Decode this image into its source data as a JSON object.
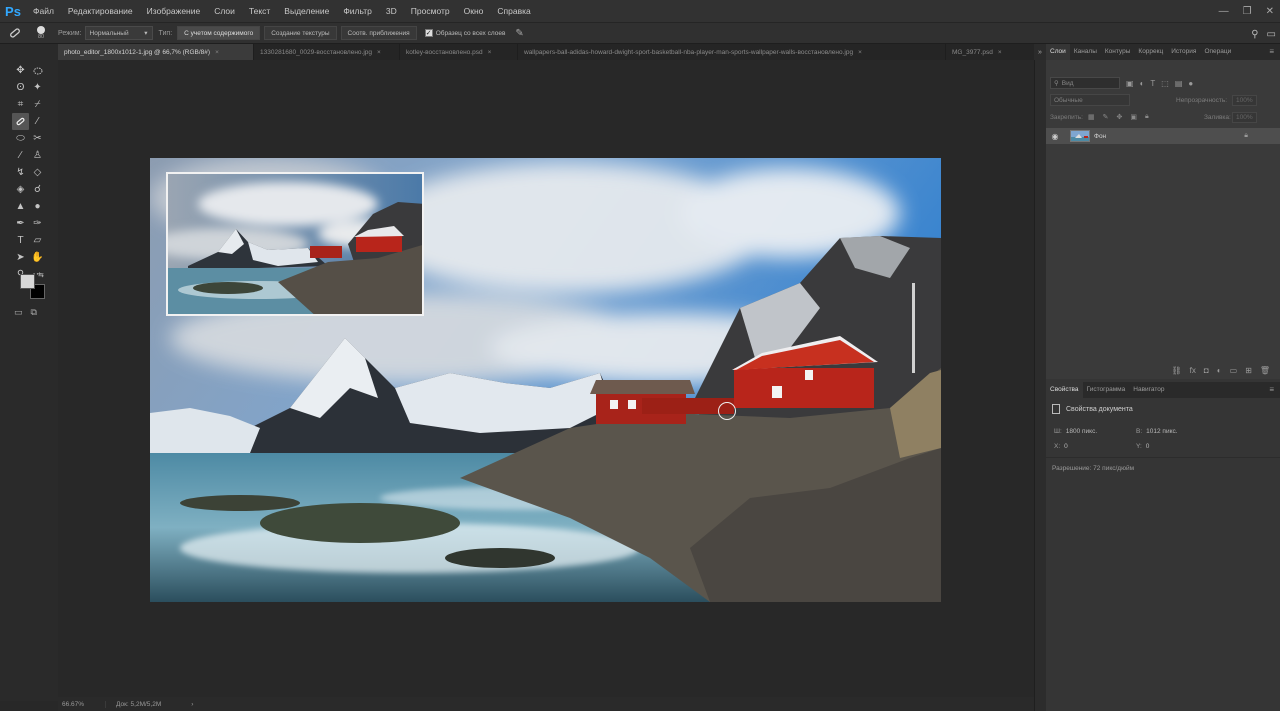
{
  "app": {
    "logo": "Ps"
  },
  "menu": [
    "Файл",
    "Редактирование",
    "Изображение",
    "Слои",
    "Текст",
    "Выделение",
    "Фильтр",
    "3D",
    "Просмотр",
    "Окно",
    "Справка"
  ],
  "window_controls": {
    "minimize": "—",
    "restore": "❐",
    "close": "✕"
  },
  "options_bar": {
    "brush_size": "80",
    "mode_label": "Режим:",
    "mode_value": "Нормальный",
    "type_label": "Тип:",
    "type_options": [
      "С учетом содержимого",
      "Создание текстуры",
      "Соотв. приближения"
    ],
    "sample_all_label": "Образец со всех слоев"
  },
  "tabs": [
    {
      "label": "photo_editor_1800x1012-1.jpg @ 66,7% (RGB/8#)",
      "active": true
    },
    {
      "label": "1330281680_0029-восстановлено.jpg",
      "active": false
    },
    {
      "label": "kotley-восстановлено.psd",
      "active": false
    },
    {
      "label": "wallpapers-ball-adidas-howard-dwight-sport-basketball-nba-player-man-sports-wallpaper-walls-восстановлено.jpg",
      "active": false
    },
    {
      "label": "MG_3977.psd",
      "active": false
    }
  ],
  "tab_close_glyph": "×",
  "statusbar": {
    "zoom": "66.67%",
    "doc_size": "Док: 5,2М/5,2М"
  },
  "layers_panel": {
    "tabs": [
      "Слои",
      "Каналы",
      "Контуры",
      "Коррекц",
      "История",
      "Операци"
    ],
    "search_placeholder": "Вид",
    "blend_mode": "Обычные",
    "opacity_label": "Непрозрачность:",
    "opacity_value": "100%",
    "lock_label": "Закрепить:",
    "fill_label": "Заливка:",
    "fill_value": "100%",
    "layer_name": "Фон"
  },
  "properties_panel": {
    "tabs": [
      "Свойства",
      "Гистограмма",
      "Навигатор"
    ],
    "title": "Свойства документа",
    "width_label": "Ш:",
    "width_value": "1800 пикс.",
    "height_label": "В:",
    "height_value": "1012 пикс.",
    "x_label": "X:",
    "x_value": "0",
    "y_label": "Y:",
    "y_value": "0",
    "resolution": "Разрешение: 72 пикс/дюйм"
  }
}
